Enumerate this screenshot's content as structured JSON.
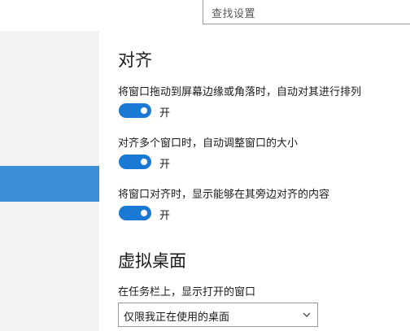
{
  "search": {
    "placeholder": "查找设置"
  },
  "snap": {
    "title": "对齐",
    "settings": [
      {
        "label": "将窗口拖动到屏幕边缘或角落时，自动对其进行排列",
        "state": "开"
      },
      {
        "label": "对齐多个窗口时，自动调整窗口的大小",
        "state": "开"
      },
      {
        "label": "将窗口对齐时，显示能够在其旁边对齐的内容",
        "state": "开"
      }
    ]
  },
  "virtual_desktops": {
    "title": "虚拟桌面",
    "taskbar_label": "在任务栏上，显示打开的窗口",
    "taskbar_value": "仅限我正在使用的桌面"
  },
  "colors": {
    "accent": "#1b79d6",
    "sidebar_selected": "#3a8fd6"
  },
  "icons": {
    "dropdown": "chevron-down-icon"
  }
}
